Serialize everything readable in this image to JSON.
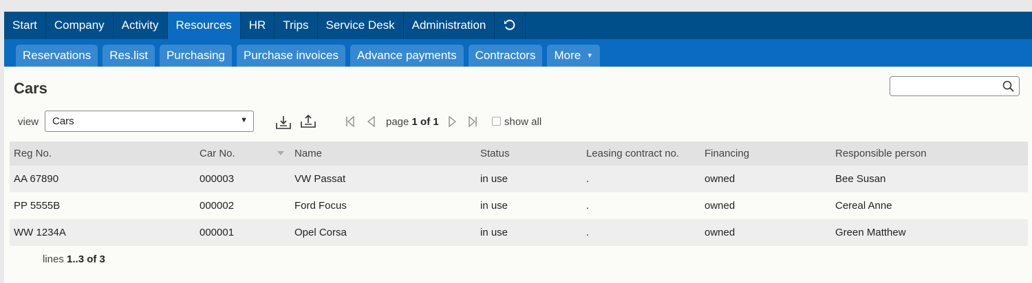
{
  "topnav": [
    {
      "label": "Start"
    },
    {
      "label": "Company"
    },
    {
      "label": "Activity"
    },
    {
      "label": "Resources",
      "active": true
    },
    {
      "label": "HR"
    },
    {
      "label": "Trips"
    },
    {
      "label": "Service Desk"
    },
    {
      "label": "Administration"
    }
  ],
  "subnav": [
    {
      "label": "Reservations"
    },
    {
      "label": "Res.list"
    },
    {
      "label": "Purchasing"
    },
    {
      "label": "Purchase invoices"
    },
    {
      "label": "Advance payments"
    },
    {
      "label": "Contractors"
    },
    {
      "label": "More"
    }
  ],
  "page": {
    "title": "Cars",
    "search_value": ""
  },
  "toolbar": {
    "view_label": "view",
    "view_value": "Cars",
    "pager_prefix": "page ",
    "pager_value": "1 of 1",
    "show_all_label": "show all"
  },
  "table": {
    "columns": [
      "Reg No.",
      "Car No.",
      "Name",
      "Status",
      "Leasing contract no.",
      "Financing",
      "Responsible person"
    ],
    "rows": [
      [
        "AA 67890",
        "000003",
        "VW Passat",
        "in use",
        ".",
        "owned",
        "Bee Susan"
      ],
      [
        "PP 5555B",
        "000002",
        "Ford Focus",
        "in use",
        ".",
        "owned",
        "Cereal Anne"
      ],
      [
        "WW 1234A",
        "000001",
        "Opel Corsa",
        "in use",
        ".",
        "owned",
        "Green Matthew"
      ]
    ]
  },
  "footer": {
    "prefix": "lines ",
    "range": "1..3 of 3"
  },
  "icons": {
    "refresh": "refresh-icon",
    "search": "search-icon",
    "import": "download-tray-icon",
    "export": "upload-tray-icon",
    "first": "first-page-icon",
    "prev": "prev-page-icon",
    "next": "next-page-icon",
    "last": "last-page-icon"
  },
  "colors": {
    "topnav_bg": "#004f8b",
    "active_bg": "#0a6bc0",
    "tab_bg": "#3689d1"
  }
}
